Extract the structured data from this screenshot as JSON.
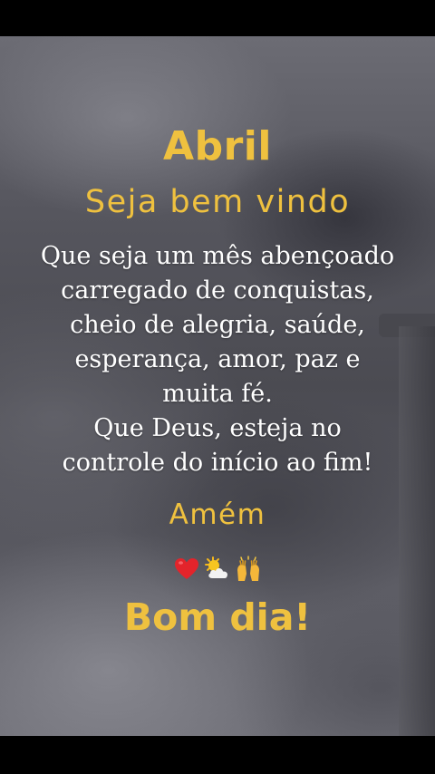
{
  "card": {
    "title": "Abril",
    "subtitle": "Seja bem vindo",
    "message_lines": [
      "Que seja um mês abençoado",
      "carregado de conquistas,",
      "cheio de alegria, saúde,",
      "esperança, amor, paz e",
      "muita fé.",
      "Que Deus, esteja no",
      "controle do início ao fim!"
    ],
    "closing": "Amém",
    "emoji_icons": [
      "heart-icon",
      "sun-behind-cloud-icon",
      "raised-hands-icon"
    ],
    "greeting": "Bom dia!"
  },
  "colors": {
    "accent": "#efc13f",
    "text": "#ffffff",
    "background": "#56565e"
  }
}
